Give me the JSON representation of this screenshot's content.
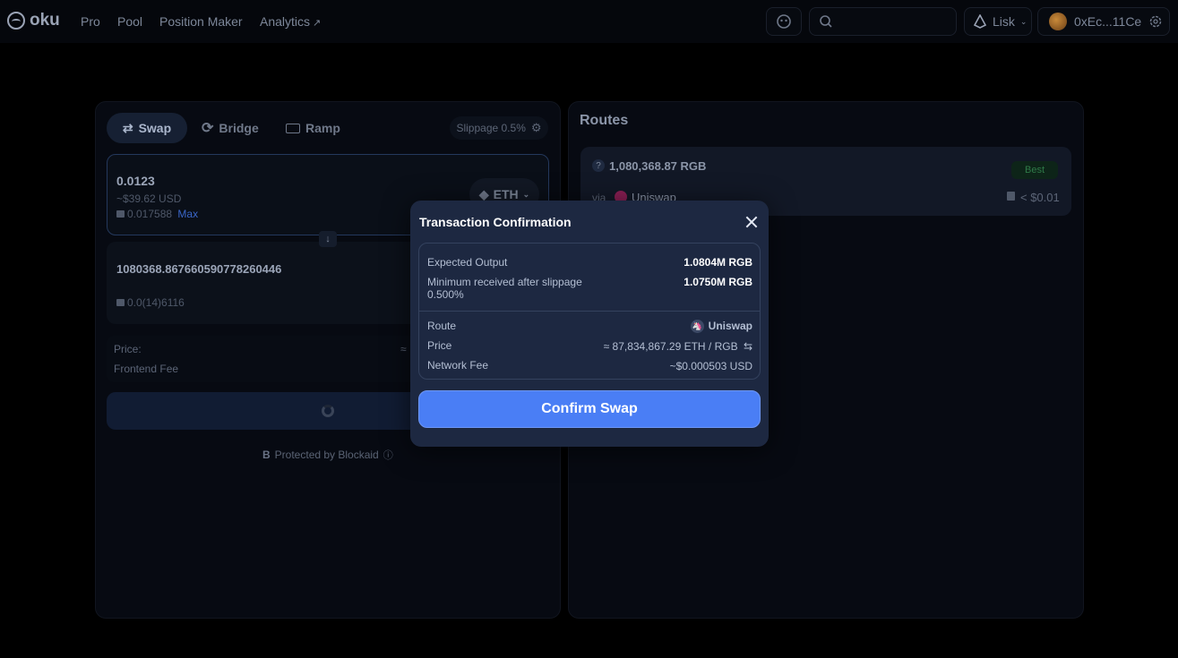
{
  "nav": {
    "logo": "oku",
    "links": [
      "Pro",
      "Pool",
      "Position Maker",
      "Analytics"
    ],
    "network": "Lisk",
    "account": "0xEc...11Ce"
  },
  "swap": {
    "tabs": [
      "Swap",
      "Bridge",
      "Ramp"
    ],
    "slippage": "Slippage 0.5%",
    "input_amount": "0.0123",
    "input_usd": "~$39.62 USD",
    "input_balance": "0.017588",
    "max_label": "Max",
    "input_token": "ETH",
    "output_amount": "1080368.867660590778260446",
    "output_balance": "0.0(14)6116",
    "price_label": "Price:",
    "price_approx": "≈",
    "fee_label": "Frontend Fee",
    "protected_label": "Protected by Blockaid"
  },
  "routes": {
    "title": "Routes",
    "card": {
      "output": "1,080,368.87 RGB",
      "badge": "Best",
      "via_label": "via",
      "protocol": "Uniswap",
      "gas": "< $0.01"
    }
  },
  "modal": {
    "title": "Transaction Confirmation",
    "expected_output_label": "Expected Output",
    "expected_output_value": "1.0804M RGB",
    "min_received_label": "Minimum received after slippage",
    "min_received_pct": "0.500%",
    "min_received_value": "1.0750M RGB",
    "route_label": "Route",
    "route_value": "Uniswap",
    "price_label": "Price",
    "price_value": "≈ 87,834,867.29 ETH / RGB",
    "fee_label": "Network Fee",
    "fee_value": "~$0.000503 USD",
    "confirm_label": "Confirm Swap"
  },
  "colors": {
    "accent": "#4a7ef5",
    "modal_bg": "#1d2841",
    "page_bg": "#000000"
  }
}
